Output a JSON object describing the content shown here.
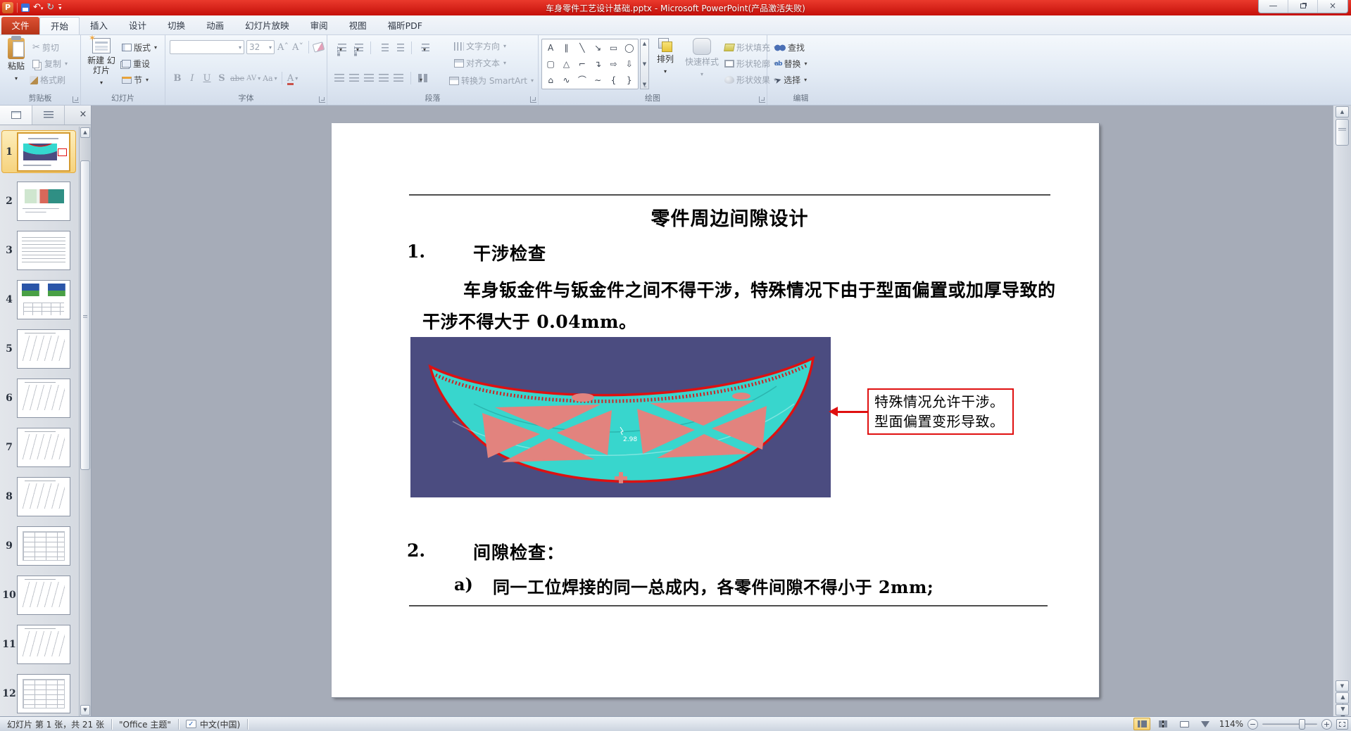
{
  "titlebar": {
    "title": "车身零件工艺设计基础.pptx - Microsoft PowerPoint(产品激活失败)",
    "minimize": "—",
    "close": "×"
  },
  "tabs": {
    "file": "文件",
    "items": [
      "开始",
      "插入",
      "设计",
      "切换",
      "动画",
      "幻灯片放映",
      "审阅",
      "视图",
      "福昕PDF"
    ]
  },
  "ribbon": {
    "clipboard": {
      "label": "剪贴板",
      "paste": "粘贴",
      "cut": "剪切",
      "copy": "复制",
      "format_painter": "格式刷"
    },
    "slides": {
      "label": "幻灯片",
      "new_slide": "新建 幻灯片",
      "layout": "版式",
      "reset": "重设",
      "section": "节"
    },
    "font": {
      "label": "字体",
      "size": "32",
      "bold": "B",
      "italic": "I",
      "underline": "U",
      "shadow": "S",
      "strike": "abe",
      "spacing": "AV",
      "case": "Aa",
      "color": "A"
    },
    "paragraph": {
      "label": "段落",
      "text_direction": "文字方向",
      "align_text": "对齐文本",
      "smartart": "转换为 SmartArt"
    },
    "drawing": {
      "label": "绘图",
      "arrange": "排列",
      "quick_styles": "快速样式",
      "shape_fill": "形状填充",
      "shape_outline": "形状轮廓",
      "shape_effects": "形状效果",
      "shapes": [
        {
          "name": "text-box",
          "glyph": "A"
        },
        {
          "name": "vertical-text-box",
          "glyph": "∥"
        },
        {
          "name": "line",
          "glyph": "╲"
        },
        {
          "name": "arrow",
          "glyph": "↘"
        },
        {
          "name": "rectangle",
          "glyph": "▭"
        },
        {
          "name": "oval",
          "glyph": "◯"
        },
        {
          "name": "rounded-rectangle",
          "glyph": "▢"
        },
        {
          "name": "triangle",
          "glyph": "△"
        },
        {
          "name": "elbow-connector",
          "glyph": "⌐"
        },
        {
          "name": "elbow-arrow-connector",
          "glyph": "↴"
        },
        {
          "name": "right-arrow",
          "glyph": "⇨"
        },
        {
          "name": "down-arrow",
          "glyph": "⇩"
        },
        {
          "name": "freeform",
          "glyph": "⌂"
        },
        {
          "name": "scribble",
          "glyph": "∿"
        },
        {
          "name": "arc",
          "glyph": "⌒"
        },
        {
          "name": "curve",
          "glyph": "∼"
        },
        {
          "name": "left-brace",
          "glyph": "{"
        },
        {
          "name": "right-brace",
          "glyph": "}"
        }
      ]
    },
    "editing": {
      "label": "编辑",
      "find": "查找",
      "replace": "替换",
      "select": "选择"
    }
  },
  "sidebar": {
    "slides": [
      {
        "num": "1"
      },
      {
        "num": "2"
      },
      {
        "num": "3"
      },
      {
        "num": "4"
      },
      {
        "num": "5"
      },
      {
        "num": "6"
      },
      {
        "num": "7"
      },
      {
        "num": "8"
      },
      {
        "num": "9"
      },
      {
        "num": "10"
      },
      {
        "num": "11"
      },
      {
        "num": "12"
      }
    ]
  },
  "slide": {
    "title": "零件周边间隙设计",
    "item1_num": "1.",
    "item1": "干涉检查",
    "body1": "车身钣金件与钣金件之间不得干涉，特殊情况下由于型面偏置或加厚导致的",
    "body2": "干涉不得大于 0.04mm。",
    "callout": "特殊情况允许干涉。型面偏置变形导致。",
    "annotation": "2.98",
    "item2_num": "2.",
    "item2": "间隙检查：",
    "item2a_num": "a)",
    "item2a": "同一工位焊接的同一总成内，各零件间隙不得小于 2mm;"
  },
  "statusbar": {
    "slide_info": "幻灯片 第 1 张，共 21 张",
    "theme": "\"Office 主题\"",
    "spell_check": "✓",
    "language": "中文(中国)",
    "zoom": "114%"
  },
  "colors": {
    "titlebar_red": "#d81c12",
    "accent_red": "#e01010",
    "part_teal": "#35d8cf",
    "cutout_pink": "#e2837e",
    "cad_background": "#4b4c80",
    "selection_orange": "#f6d27c"
  }
}
